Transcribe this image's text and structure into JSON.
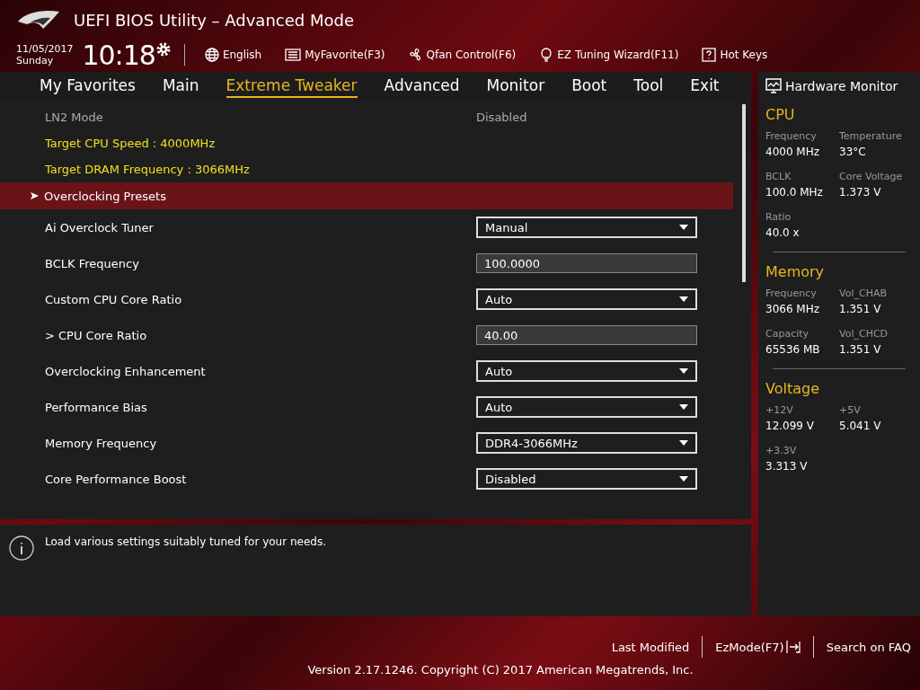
{
  "header": {
    "title": "UEFI BIOS Utility – Advanced Mode",
    "date": "11/05/2017",
    "day": "Sunday",
    "time": "10:18",
    "tools": [
      {
        "kind": "language",
        "label": "English"
      },
      {
        "kind": "favorite",
        "label": "MyFavorite(F3)"
      },
      {
        "kind": "fan",
        "label": "Qfan Control(F6)"
      },
      {
        "kind": "wizard",
        "label": "EZ Tuning Wizard(F11)"
      },
      {
        "kind": "help",
        "label": "Hot Keys"
      }
    ]
  },
  "tabs": [
    {
      "label": "My Favorites",
      "selected": false
    },
    {
      "label": "Main",
      "selected": false
    },
    {
      "label": "Extreme Tweaker",
      "selected": true
    },
    {
      "label": "Advanced",
      "selected": false
    },
    {
      "label": "Monitor",
      "selected": false
    },
    {
      "label": "Boot",
      "selected": false
    },
    {
      "label": "Tool",
      "selected": false
    },
    {
      "label": "Exit",
      "selected": false
    }
  ],
  "settings": [
    {
      "kind": "readonly",
      "label": "LN2 Mode",
      "value": "Disabled"
    },
    {
      "kind": "info",
      "label": "Target CPU Speed : 4000MHz"
    },
    {
      "kind": "info",
      "label": "Target DRAM Frequency : 3066MHz"
    },
    {
      "kind": "submenu",
      "label": "Overclocking Presets",
      "selected": true
    },
    {
      "kind": "dropdown",
      "label": "Ai Overclock Tuner",
      "value": "Manual"
    },
    {
      "kind": "input",
      "label": "BCLK Frequency",
      "value": "100.0000"
    },
    {
      "kind": "dropdown",
      "label": "Custom CPU Core Ratio",
      "value": "Auto"
    },
    {
      "kind": "input",
      "label": "> CPU Core Ratio",
      "value": "40.00"
    },
    {
      "kind": "dropdown",
      "label": "Overclocking Enhancement",
      "value": "Auto"
    },
    {
      "kind": "dropdown",
      "label": "Performance Bias",
      "value": "Auto"
    },
    {
      "kind": "dropdown",
      "label": "Memory Frequency",
      "value": "DDR4-3066MHz"
    },
    {
      "kind": "dropdown",
      "label": "Core Performance Boost",
      "value": "Disabled"
    }
  ],
  "help": {
    "text": "Load various settings suitably tuned for your needs."
  },
  "hardware_monitor": {
    "title": "Hardware Monitor",
    "sections": [
      {
        "title": "CPU",
        "items": [
          {
            "label": "Frequency",
            "value": "4000 MHz"
          },
          {
            "label": "Temperature",
            "value": "33°C"
          },
          {
            "label": "BCLK",
            "value": "100.0 MHz"
          },
          {
            "label": "Core Voltage",
            "value": "1.373 V"
          },
          {
            "label": "Ratio",
            "value": "40.0 x"
          }
        ]
      },
      {
        "title": "Memory",
        "items": [
          {
            "label": "Frequency",
            "value": "3066 MHz"
          },
          {
            "label": "Vol_CHAB",
            "value": "1.351 V"
          },
          {
            "label": "Capacity",
            "value": "65536 MB"
          },
          {
            "label": "Vol_CHCD",
            "value": "1.351 V"
          }
        ]
      },
      {
        "title": "Voltage",
        "items": [
          {
            "label": "+12V",
            "value": "12.099 V"
          },
          {
            "label": "+5V",
            "value": "5.041 V"
          },
          {
            "label": "+3.3V",
            "value": "3.313 V"
          }
        ]
      }
    ]
  },
  "footer": {
    "links": [
      {
        "kind": "plain",
        "label": "Last Modified"
      },
      {
        "kind": "exit",
        "label": "EzMode(F7)"
      },
      {
        "kind": "plain",
        "label": "Search on FAQ"
      }
    ],
    "version": "Version 2.17.1246. Copyright (C) 2017 American Megatrends, Inc."
  }
}
